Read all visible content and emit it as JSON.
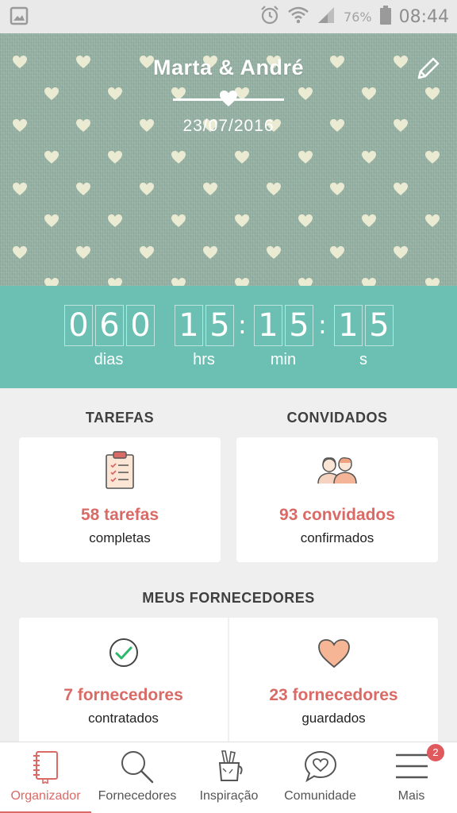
{
  "status_bar": {
    "battery": "76%",
    "time": "08:44"
  },
  "header": {
    "couple_names": "Marta & André",
    "date": "23/07/2016"
  },
  "countdown": {
    "days": [
      "0",
      "6",
      "0"
    ],
    "hours": [
      "1",
      "5"
    ],
    "minutes": [
      "1",
      "5"
    ],
    "seconds": [
      "1",
      "5"
    ],
    "separator": ":",
    "labels": {
      "days": "dias",
      "hours": "hrs",
      "minutes": "min",
      "seconds": "s"
    }
  },
  "tasks": {
    "title": "TAREFAS",
    "count": "58 tarefas",
    "caption": "completas"
  },
  "guests": {
    "title": "CONVIDADOS",
    "count": "93 convidados",
    "caption": "confirmados"
  },
  "vendors": {
    "title": "MEUS FORNECEDORES",
    "hired_count": "7 fornecedores",
    "hired_caption": "contratados",
    "saved_count": "23 fornecedores",
    "saved_caption": "guardados"
  },
  "bottom_nav": {
    "items": [
      {
        "label": "Organizador",
        "icon": "notebook-icon",
        "active": true
      },
      {
        "label": "Fornecedores",
        "icon": "search-icon",
        "active": false
      },
      {
        "label": "Inspiração",
        "icon": "pencil-cup-icon",
        "active": false
      },
      {
        "label": "Comunidade",
        "icon": "chat-heart-icon",
        "active": false
      },
      {
        "label": "Mais",
        "icon": "menu-icon",
        "active": false
      }
    ],
    "more_badge": "2"
  },
  "colors": {
    "accent": "#d96a66",
    "teal": "#6cc0b3",
    "header_bg": "#95b1a3"
  }
}
